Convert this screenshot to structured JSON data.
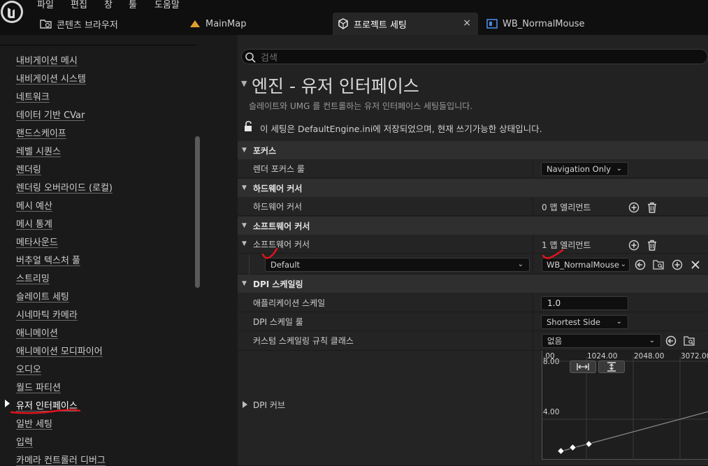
{
  "menu": [
    "파일",
    "편집",
    "창",
    "툴",
    "도움말"
  ],
  "tabs": [
    {
      "label": "콘텐츠 브라우저",
      "icon": "content-browser-icon"
    },
    {
      "label": "MainMap",
      "icon": "level-icon"
    },
    {
      "label": "프로젝트 세팅",
      "icon": "project-settings-icon",
      "active": true,
      "close": "×"
    },
    {
      "label": "WB_NormalMouse",
      "icon": "widget-blueprint-icon"
    }
  ],
  "sidebar": {
    "items": [
      "내비게이션 메시",
      "내비게이션 시스템",
      "네트워크",
      "데이터 기반 CVar",
      "랜드스케이프",
      "레벨 시퀀스",
      "렌더링",
      "렌더링 오버라이드 (로컬)",
      "메시 예산",
      "메시 통계",
      "메타사운드",
      "버추얼 텍스처 풀",
      "스트리밍",
      "슬레이트 세팅",
      "시네마틱 카메라",
      "애니메이션",
      "애니메이션 모디파이어",
      "오디오",
      "월드 파티션",
      "유저 인터페이스",
      "일반 세팅",
      "입력",
      "카메라 컨트롤러 디버그"
    ],
    "selected_index": 19
  },
  "search": {
    "placeholder": "검색"
  },
  "page": {
    "title": "엔진 - 유저 인터페이스",
    "subtitle": "슬레이트와 UMG 를 컨트롤하는 유저 인터페이스 세팅들입니다.",
    "lock_note": "이 세팅은 DefaultEngine.ini에 저장되었으며, 현재 쓰기가능한 상태입니다."
  },
  "sections": {
    "focus": {
      "header": "포커스",
      "render_focus_rule": {
        "label": "렌더 포커스 룰",
        "value": "Navigation Only"
      }
    },
    "hardware_cursor": {
      "header": "하드웨어 커서",
      "row": {
        "label": "하드웨어 커서",
        "value": "0 맵 엘리먼트"
      }
    },
    "software_cursor": {
      "header": "소프트웨어 커서",
      "row": {
        "label": "소프트웨어 커서",
        "value": "1 맵 엘리먼트"
      },
      "entry": {
        "key": "Default",
        "value": "WB_NormalMouse"
      }
    },
    "dpi": {
      "header": "DPI 스케일링",
      "app_scale": {
        "label": "애플리케이션 스케일",
        "value": "1.0"
      },
      "dpi_rule": {
        "label": "DPI 스케일 룰",
        "value": "Shortest Side"
      },
      "custom_rule": {
        "label": "커스텀 스케일링 규칙 클래스",
        "value": "없음"
      },
      "curve": {
        "label": "DPI 커브",
        "x_ticks": [
          ".00",
          "1024.00",
          "2048.00",
          "3072.00"
        ],
        "y_ticks": [
          "8.00",
          "4.00"
        ]
      }
    }
  },
  "colors": {
    "accent_red": "#e0141e"
  }
}
